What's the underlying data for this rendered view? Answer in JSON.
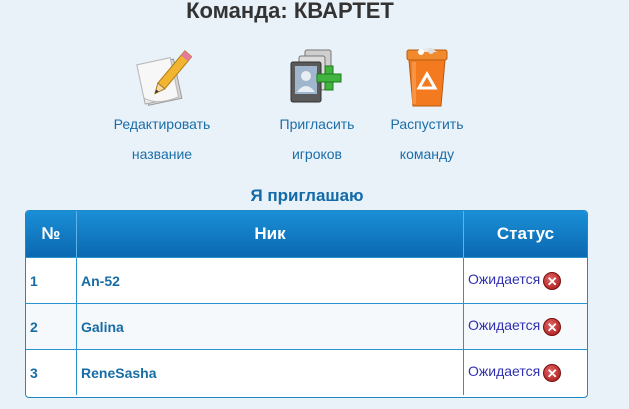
{
  "page": {
    "title": "Команда: КВАРТЕТ"
  },
  "actions": {
    "rename": {
      "line1": "Редактировать",
      "line2": "название",
      "icon": "edit-note-icon"
    },
    "invite": {
      "line1": "Пригласить",
      "line2": "игроков",
      "icon": "add-player-icon"
    },
    "disband": {
      "line1": "Распустить",
      "line2": "команду",
      "icon": "recycle-bin-icon"
    }
  },
  "section": {
    "title": "Я приглашаю"
  },
  "table": {
    "headers": {
      "num": "№",
      "nick": "Ник",
      "status": "Статус"
    },
    "rows": [
      {
        "num": "1",
        "nick": "An-52",
        "status": "Ожидается"
      },
      {
        "num": "2",
        "nick": "Galina",
        "status": "Ожидается"
      },
      {
        "num": "3",
        "nick": "ReneSasha",
        "status": "Ожидается"
      }
    ]
  },
  "colors": {
    "accent": "#126aa8",
    "header_bg": "#0b68b1",
    "cancel": "#a51515"
  }
}
